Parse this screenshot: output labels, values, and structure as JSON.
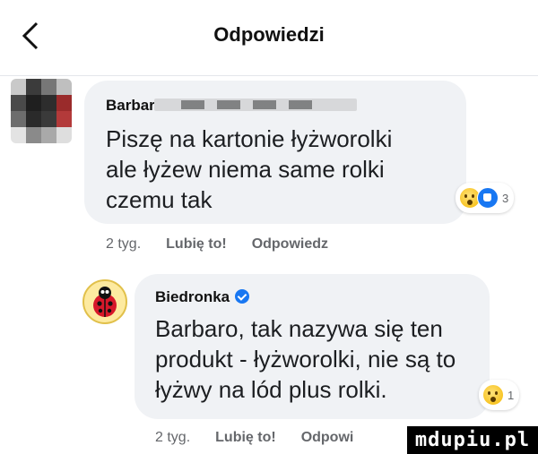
{
  "header": {
    "title": "Odpowiedzi",
    "back_icon": "chevron-left-icon"
  },
  "comments": [
    {
      "author": "Barbara",
      "text_lines": [
        "Piszę na kartonie łyżworolki",
        "ale łyżew niema same rolki",
        "czemu tak"
      ],
      "reaction_count": "3",
      "time": "2 tyg.",
      "like_label": "Lubię to!",
      "reply_label": "Odpowiedz"
    },
    {
      "author": "Biedronka",
      "text_lines": [
        "Barbaro, tak nazywa się ten",
        "produkt - łyżworolki, nie są to",
        "łyżwy na lód plus rolki."
      ],
      "reaction_count": "1",
      "time": "2 tyg.",
      "like_label": "Lubię to!",
      "reply_label": "Odpowi"
    }
  ],
  "watermark": "mdupiu.pl",
  "colors": {
    "bubble": "#f0f2f5",
    "secondary_text": "#65676b",
    "accent": "#1877f2"
  }
}
